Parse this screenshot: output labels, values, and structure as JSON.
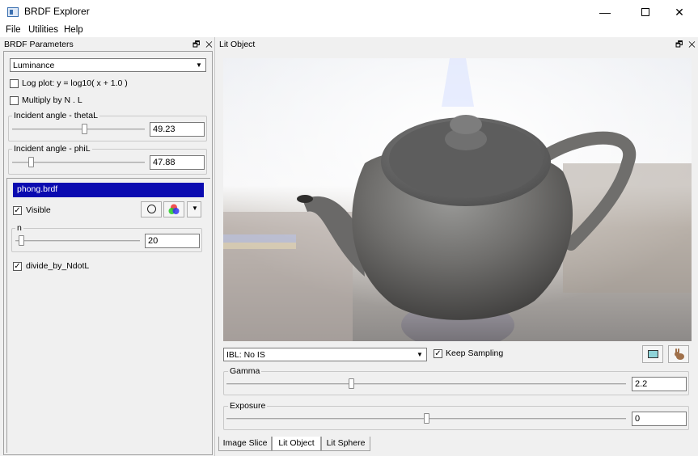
{
  "window": {
    "title": "BRDF Explorer",
    "minimize": "—",
    "close": "✕"
  },
  "menu": {
    "file": "File",
    "utilities": "Utilities",
    "help": "Help"
  },
  "left_dock": {
    "title": "BRDF Parameters",
    "dock_buttons": "🗗 ✕",
    "channel_select": "Luminance",
    "log_plot_label": "Log plot:  y = log10( x + 1.0 )",
    "log_plot_checked": false,
    "multiply_label": "Multiply by N . L",
    "multiply_checked": false,
    "theta": {
      "label": "Incident angle - thetaL",
      "value": "49.23",
      "fraction": 0.55
    },
    "phi": {
      "label": "Incident angle - phiL",
      "value": "47.88",
      "fraction": 0.13
    },
    "brdf_file": "phong.brdf",
    "visible_label": "Visible",
    "visible_checked": true,
    "n_param": {
      "label": "n",
      "value": "20",
      "fraction": 0.03
    },
    "divide_label": "divide_by_NdotL",
    "divide_checked": true
  },
  "right_dock": {
    "title": "Lit Object",
    "dock_buttons": "🗗 ✕",
    "ibl_select": "IBL: No IS",
    "keep_sampling_label": "Keep Sampling",
    "keep_sampling_checked": true,
    "gamma": {
      "label": "Gamma",
      "value": "2.2",
      "fraction": 0.31
    },
    "exposure": {
      "label": "Exposure",
      "value": "0",
      "fraction": 0.5
    },
    "tabs": [
      "Image Slice",
      "Lit Object",
      "Lit Sphere"
    ],
    "active_tab": "Lit Object"
  },
  "icons": {
    "app": "app-window-icon",
    "circle": "circle-icon",
    "color": "color-wheel-icon",
    "screenshot": "screen-capture-icon",
    "rabbit": "rabbit-icon"
  },
  "colors": {
    "selection": "#0a0ab0",
    "window_bg": "#f0f0f0"
  }
}
